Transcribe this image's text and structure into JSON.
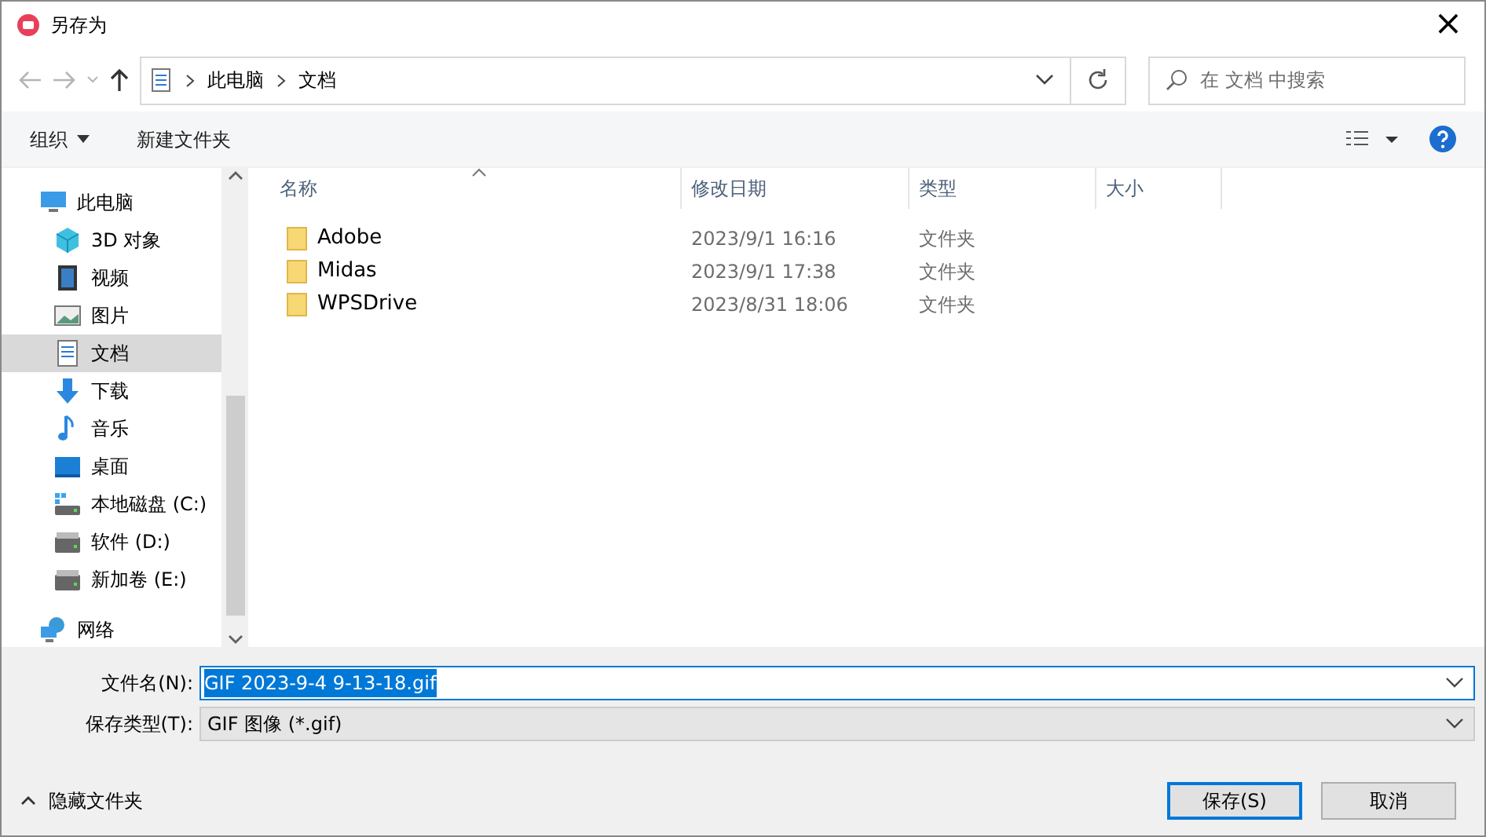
{
  "window": {
    "title": "另存为",
    "close": "×"
  },
  "address": {
    "path": [
      "此电脑",
      "文档"
    ]
  },
  "search": {
    "placeholder": "在 文档 中搜索"
  },
  "toolbar": {
    "organize": "组织",
    "new_folder": "新建文件夹"
  },
  "sidebar": {
    "items": [
      {
        "label": "此电脑",
        "kind": "pc",
        "selected": false,
        "children": [
          {
            "label": "3D 对象",
            "kind": "cube",
            "selected": false
          },
          {
            "label": "视频",
            "kind": "video",
            "selected": false
          },
          {
            "label": "图片",
            "kind": "image",
            "selected": false
          },
          {
            "label": "文档",
            "kind": "doc",
            "selected": true
          },
          {
            "label": "下载",
            "kind": "download",
            "selected": false
          },
          {
            "label": "音乐",
            "kind": "music",
            "selected": false
          },
          {
            "label": "桌面",
            "kind": "desktop",
            "selected": false
          },
          {
            "label": "本地磁盘 (C:)",
            "kind": "sysdrive",
            "selected": false
          },
          {
            "label": "软件 (D:)",
            "kind": "drive",
            "selected": false
          },
          {
            "label": "新加卷 (E:)",
            "kind": "drive",
            "selected": false
          }
        ]
      },
      {
        "label": "网络",
        "kind": "network",
        "selected": false
      }
    ]
  },
  "table": {
    "columns": [
      "名称",
      "修改日期",
      "类型",
      "大小"
    ],
    "rows": [
      {
        "name": "Adobe",
        "date": "2023/9/1 16:16",
        "type": "文件夹"
      },
      {
        "name": "Midas",
        "date": "2023/9/1 17:38",
        "type": "文件夹"
      },
      {
        "name": "WPSDrive",
        "date": "2023/8/31 18:06",
        "type": "文件夹"
      }
    ]
  },
  "filename": {
    "label": "文件名(N):",
    "value": "GIF 2023-9-4 9-13-18.gif",
    "selected": true
  },
  "filetype": {
    "label": "保存类型(T):",
    "value": "GIF 图像 (*.gif)"
  },
  "hide_folders": "隐藏文件夹",
  "buttons": [
    {
      "label": "保存(S)",
      "default": true
    },
    {
      "label": "取消",
      "default": false
    }
  ]
}
